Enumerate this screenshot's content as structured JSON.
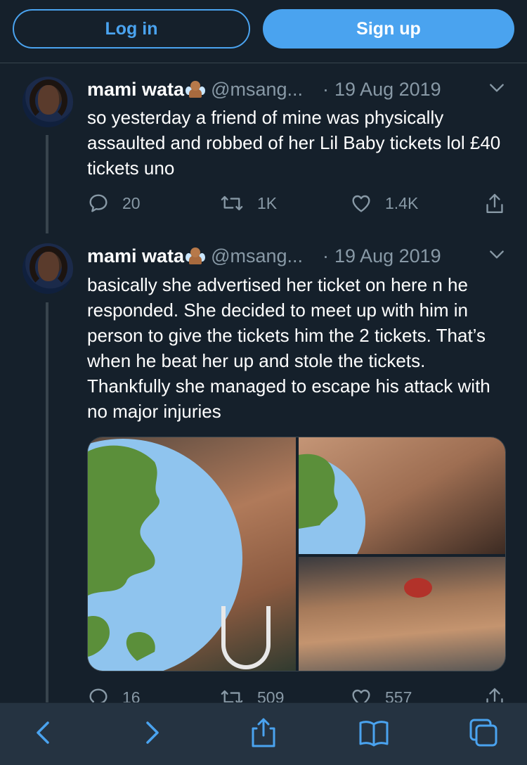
{
  "auth": {
    "login_label": "Log in",
    "signup_label": "Sign up"
  },
  "tweets": [
    {
      "name": "mami wata",
      "handle": "@msang...",
      "dot": "·",
      "date": "19 Aug 2019",
      "text": "so yesterday a friend of mine was physically assaulted and robbed of her Lil Baby tickets lol £40 tickets uno",
      "replies": "20",
      "retweets": "1K",
      "likes": "1.4K"
    },
    {
      "name": "mami wata",
      "handle": "@msang...",
      "dot": "·",
      "date": "19 Aug 2019",
      "text": "basically she advertised her ticket on here n he responded. She decided to meet up with him in person to give the tickets him the 2 tickets. That’s when he beat her up and stole the tickets. Thankfully she managed to escape his attack with no major injuries",
      "media_count": 3,
      "replies": "16",
      "retweets": "509",
      "likes": "557"
    }
  ],
  "browser_toolbar": {
    "items": [
      "back-icon",
      "forward-icon",
      "share-icon",
      "bookmarks-icon",
      "tabs-icon"
    ]
  },
  "colors": {
    "background": "#15202b",
    "accent": "#4aa3ef",
    "secondary_text": "#8899a6",
    "toolbar": "#253341"
  }
}
